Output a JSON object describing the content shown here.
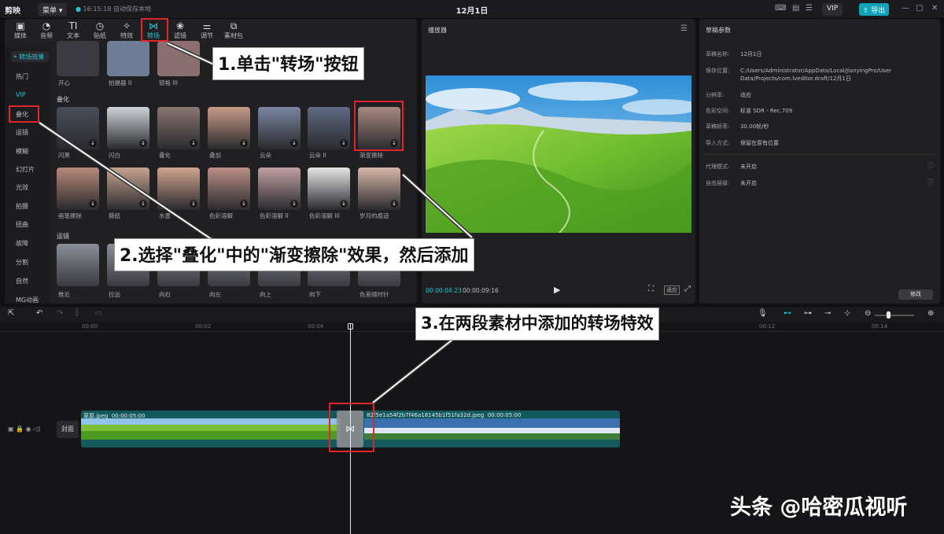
{
  "topbar": {
    "app_name": "剪映",
    "menu_label": "菜单",
    "autosave": "16:15:18 自动保存本地",
    "project_title": "12月1日",
    "vip_label": "VIP",
    "export_label": "导出"
  },
  "categories": [
    {
      "icon": "media-icon",
      "label": "媒体"
    },
    {
      "icon": "audio-icon",
      "label": "音频"
    },
    {
      "icon": "text-icon",
      "label": "文本"
    },
    {
      "icon": "sticker-icon",
      "label": "贴纸"
    },
    {
      "icon": "effects-icon",
      "label": "特效"
    },
    {
      "icon": "transition-icon",
      "label": "转场"
    },
    {
      "icon": "filter-icon",
      "label": "滤镜"
    },
    {
      "icon": "adjust-icon",
      "label": "调节"
    },
    {
      "icon": "package-icon",
      "label": "素材包"
    }
  ],
  "sidebar": {
    "header": "• 转场效果",
    "items": [
      "热门",
      "VIP",
      "叠化",
      "运镜",
      "模糊",
      "幻灯片",
      "光效",
      "拍摄",
      "扭曲",
      "故障",
      "分割",
      "自然",
      "MG动画"
    ]
  },
  "transitions": {
    "top_row": [
      "开心",
      "拍摄器 II",
      "锁格 III"
    ],
    "section_overlay": "叠化",
    "overlay_row1": [
      "闪黑",
      "闪白",
      "叠化",
      "叠加",
      "云朵",
      "云朵 II",
      "渐变擦除"
    ],
    "overlay_row2": [
      "画笔擦除",
      "撕纸",
      "水墨",
      "色彩溶解",
      "色彩溶解 II",
      "色彩溶解 III",
      "岁月的痕迹"
    ],
    "section_camera": "运镜",
    "camera_row": [
      "推近",
      "拉远",
      "向右",
      "向左",
      "向上",
      "向下",
      "色差顺时针"
    ]
  },
  "player": {
    "title": "播放器",
    "current_time": "00:00:04:23",
    "total_time": "00:00:09:16",
    "ratio_label": "适应"
  },
  "props": {
    "title": "草稿参数",
    "rows": [
      {
        "k": "草稿名称:",
        "v": "12月1日"
      },
      {
        "k": "保存位置:",
        "v": "C:/Users/Administrator/AppData/Local/JianyingPro/User Data/Projects/com.lveditor.draft/12月1日"
      },
      {
        "k": "分辨率:",
        "v": "适应"
      },
      {
        "k": "色彩空间:",
        "v": "标准 SDR - Rec.709"
      },
      {
        "k": "草稿帧率:",
        "v": "30.00帧/秒"
      },
      {
        "k": "导入方式:",
        "v": "保留在原有位置"
      },
      {
        "k": "代理模式:",
        "v": "未开启"
      },
      {
        "k": "自由层级:",
        "v": "未开启"
      }
    ],
    "modify_label": "修改"
  },
  "timeline": {
    "ruler": [
      "00:00",
      "00:02",
      "00:04",
      "00:12",
      "00:14"
    ],
    "cover_label": "封面",
    "clip1": {
      "name": "草原.jpeg",
      "duration": "00:00:05:00"
    },
    "clip2": {
      "name": "82f5e1a54f2b7f46a18145b1f51fa32d.jpeg",
      "duration": "00:00:05:00"
    }
  },
  "annotations": {
    "step1": "1.单击\"转场\"按钮",
    "step2": "2.选择\"叠化\"中的\"渐变擦除\"效果，然后添加",
    "step3": "3.在两段素材中添加的转场特效"
  },
  "watermark": "头条 @哈密瓜视听",
  "colors": {
    "accent": "#22c7d6",
    "highlight": "#e0262a",
    "track": "#12595e"
  }
}
